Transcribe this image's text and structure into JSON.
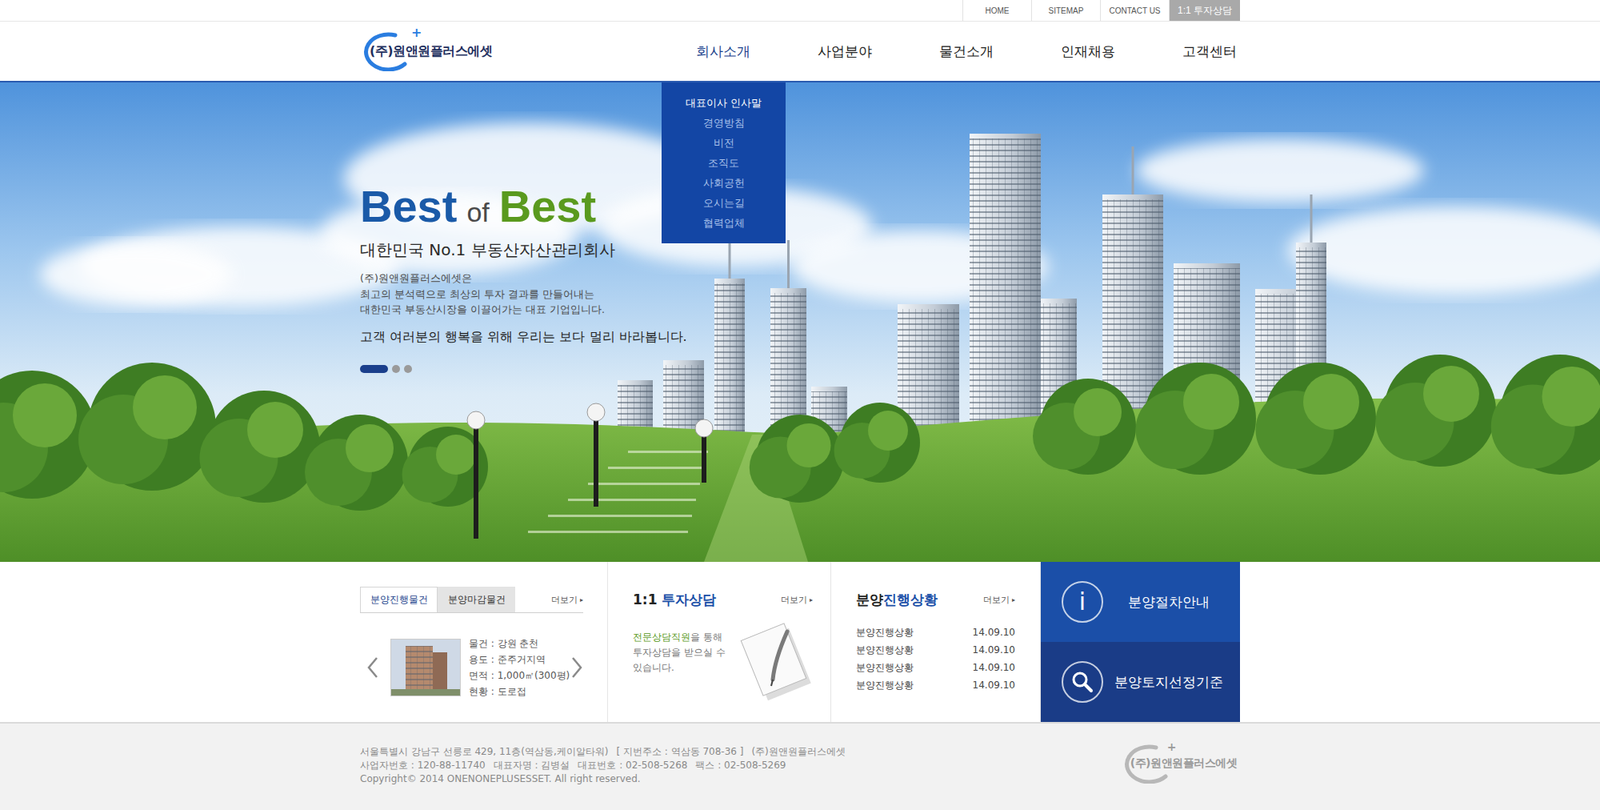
{
  "top_links": [
    {
      "label": "HOME",
      "highlighted": false
    },
    {
      "label": "SITEMAP",
      "highlighted": false
    },
    {
      "label": "CONTACT US",
      "highlighted": false
    },
    {
      "label": "1:1 투자상담",
      "highlighted": true
    }
  ],
  "logo": {
    "text": "(주)원앤원플러스에셋",
    "mark": "+"
  },
  "nav": [
    {
      "label": "회사소개",
      "selected": true,
      "expanded": true
    },
    {
      "label": "사업분야",
      "selected": false,
      "expanded": false
    },
    {
      "label": "물건소개",
      "selected": false,
      "expanded": false
    },
    {
      "label": "인재채용",
      "selected": false,
      "expanded": false
    },
    {
      "label": "고객센터",
      "selected": false,
      "expanded": false
    }
  ],
  "dropdown": [
    {
      "label": "대표이사 인사말",
      "selected": true
    },
    {
      "label": "경영방침",
      "selected": false
    },
    {
      "label": "비전",
      "selected": false
    },
    {
      "label": "조직도",
      "selected": false
    },
    {
      "label": "사회공헌",
      "selected": false
    },
    {
      "label": "오시는길",
      "selected": false
    },
    {
      "label": "협력업체",
      "selected": false
    }
  ],
  "hero": {
    "title": [
      "Best",
      "of",
      "Best"
    ],
    "subtitle": "대한민국 No.1 부동산자산관리회사",
    "body": [
      "(주)원앤원플러스에셋은",
      "최고의 분석력으로 최상의 투자 결과를 만들어내는",
      "대한민국 부동산시장을 이끌어가는 대표 기업입니다."
    ],
    "tagline": "고객 여러분의 행복을 위해 우리는 보다 멀리 바라봅니다.",
    "slides": [
      {
        "selected": true
      },
      {
        "selected": false
      },
      {
        "selected": false
      }
    ]
  },
  "listings": {
    "tabs": [
      {
        "label": "분양진행물건",
        "selected": true
      },
      {
        "label": "분양마감물건",
        "selected": false
      }
    ],
    "more": "더보기",
    "more_icon": "▸",
    "details": [
      "물건 : 강원 춘천",
      "용도 : 준주거지역",
      "면적 : 1,000㎡(300평)",
      "현황 : 도로접"
    ]
  },
  "consult": {
    "title": [
      "1:1",
      "투자상담"
    ],
    "more": "더보기",
    "more_icon": "▸",
    "highlight": "전문상담직원",
    "text": "을 통해 투자상담을 받으실 수 있습니다."
  },
  "progress": {
    "title": [
      "분양",
      "진행상황"
    ],
    "more": "더보기",
    "more_icon": "▸",
    "rows": [
      {
        "title": "분양진행상황",
        "date": "14.09.10"
      },
      {
        "title": "분양진행상황",
        "date": "14.09.10"
      },
      {
        "title": "분양진행상황",
        "date": "14.09.10"
      },
      {
        "title": "분양진행상황",
        "date": "14.09.10"
      }
    ]
  },
  "quick_links": [
    {
      "label": "분양절차안내",
      "kind": "info",
      "icon": "i",
      "color": "#1b4fa8"
    },
    {
      "label": "분양토지선정기준",
      "kind": "search",
      "color": "#1a3c87"
    }
  ],
  "footer": {
    "lines": [
      [
        "서울특별시 강남구 선릉로 429, 11층(역삼동,케이알타워)",
        "[ 지번주소 : 역삼동 708-36 ]",
        "(주)원앤원플러스에셋"
      ],
      [
        "사업자번호 : 120-88-11740",
        "대표자명 : 김병설",
        "대표번호 : 02-508-5268",
        "팩스 : 02-508-5269"
      ],
      [
        "Copyright© 2014 ONENONEPLUSESSET. All right reserved."
      ]
    ],
    "logo": {
      "text": "(주)원앤원플러스에셋",
      "mark": "+"
    }
  }
}
